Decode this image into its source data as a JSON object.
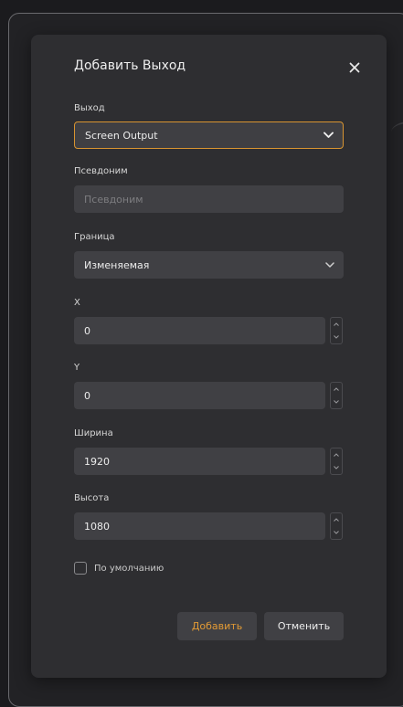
{
  "dialog": {
    "title": "Добавить Выход",
    "close_icon": "close-icon"
  },
  "fields": {
    "output": {
      "label": "Выход",
      "value": "Screen Output",
      "icon": "chevron-down-icon"
    },
    "alias": {
      "label": "Псевдоним",
      "value": "",
      "placeholder": "Псевдоним"
    },
    "border": {
      "label": "Граница",
      "value": "Изменяемая",
      "icon": "chevron-down-icon"
    },
    "x": {
      "label": "X",
      "value": "0"
    },
    "y": {
      "label": "Y",
      "value": "0"
    },
    "width": {
      "label": "Ширина",
      "value": "1920"
    },
    "height": {
      "label": "Высота",
      "value": "1080"
    }
  },
  "default_checkbox": {
    "label": "По умолчанию",
    "checked": false
  },
  "buttons": {
    "add_label": "Добавить",
    "cancel_label": "Отменить"
  },
  "colors": {
    "accent": "#d89431",
    "dialog_bg": "#2e2e31",
    "field_bg": "#404044",
    "page_bg": "#1b1b1e"
  }
}
